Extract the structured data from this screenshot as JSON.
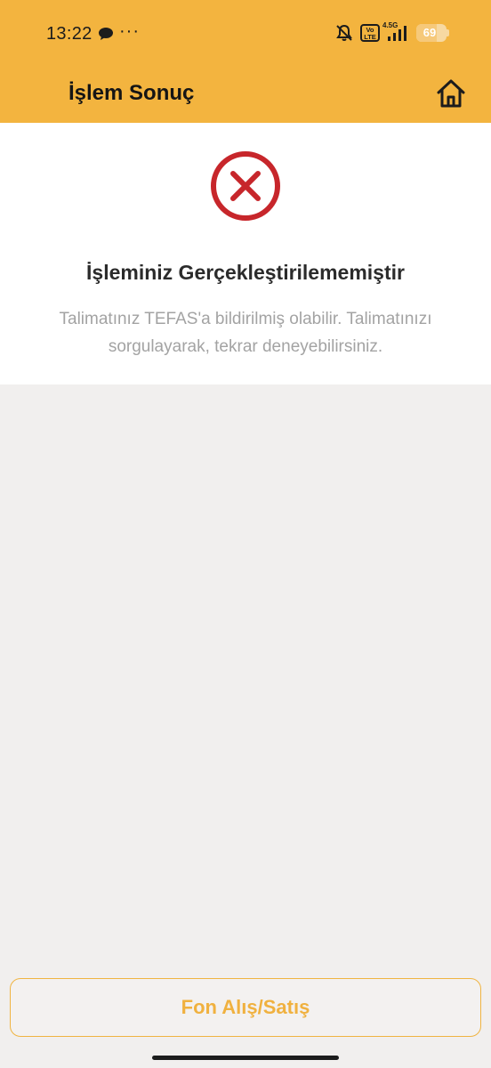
{
  "status_bar": {
    "time": "13:22",
    "more": "···",
    "network_badge": "Vo LTE",
    "network_type": "4.5G",
    "battery_level": 69,
    "battery_text": "69"
  },
  "header": {
    "title": "İşlem Sonuç",
    "home_icon": "home-icon"
  },
  "result": {
    "status_icon": "error-circle-x-icon",
    "title": "İşleminiz Gerçekleştirilememiştir",
    "message": "Talimatınız TEFAS'a bildirilmiş olabilir. Talimatınızı sorgulayarak, tekrar deneyebilirsiniz."
  },
  "actions": {
    "fund_button_label": "Fon Alış/Satış"
  },
  "colors": {
    "brand": "#f3b43f",
    "error": "#c7262b",
    "background": "#f1efee"
  }
}
